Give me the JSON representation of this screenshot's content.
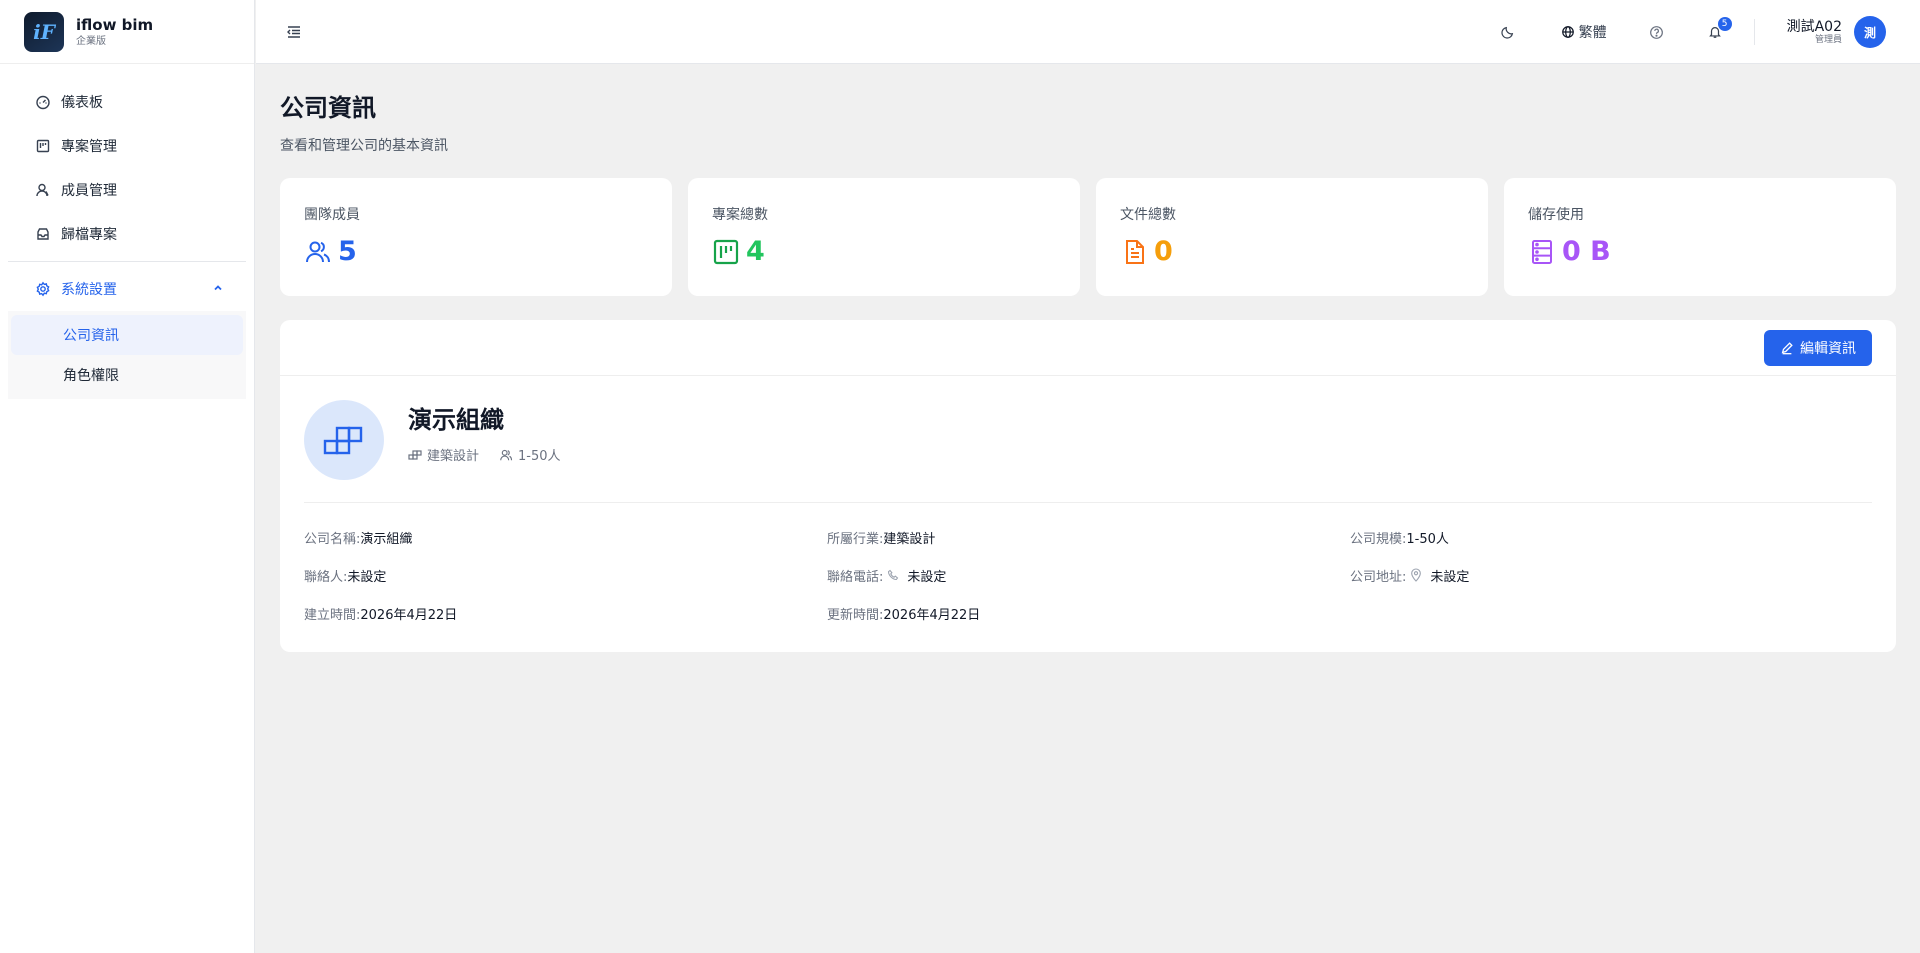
{
  "brand": {
    "logo_text": "iF",
    "name": "iflow bim",
    "edition": "企業版"
  },
  "nav": {
    "items": [
      {
        "label": "儀表板",
        "icon": "dashboard-icon"
      },
      {
        "label": "專案管理",
        "icon": "kanban-icon"
      },
      {
        "label": "成員管理",
        "icon": "user-icon"
      },
      {
        "label": "歸檔專案",
        "icon": "archive-icon"
      }
    ],
    "settings": {
      "label": "系統設置",
      "icon": "gear-icon",
      "expanded": true
    },
    "sub_items": [
      {
        "label": "公司資訊",
        "active": true
      },
      {
        "label": "角色權限",
        "active": false
      }
    ]
  },
  "header": {
    "language_label": "繁體",
    "notification_count": "5",
    "user_name": "測試A02",
    "user_role": "管理員",
    "avatar_text": "測"
  },
  "page": {
    "title": "公司資訊",
    "subtitle": "查看和管理公司的基本資訊"
  },
  "stats": [
    {
      "label": "團隊成員",
      "value": "5",
      "color": "#2563eb",
      "icon": "users-icon"
    },
    {
      "label": "專案總數",
      "value": "4",
      "color": "#22c55e",
      "icon": "kanban-icon"
    },
    {
      "label": "文件總數",
      "value": "0",
      "color": "#f59e0b",
      "icon": "file-icon"
    },
    {
      "label": "儲存使用",
      "value": "0 B",
      "color": "#a855f7",
      "icon": "server-icon"
    }
  ],
  "company": {
    "edit_label": "編輯資訊",
    "name": "演示組織",
    "industry_tag": "建築設計",
    "size_tag": "1-50人",
    "details": {
      "name_label": "公司名稱:",
      "name_value": "演示組織",
      "industry_label": "所屬行業:",
      "industry_value": "建築設計",
      "size_label": "公司規模:",
      "size_value": "1-50人",
      "contact_label": "聯絡人:",
      "contact_value": "未設定",
      "phone_label": "聯絡電話:",
      "phone_value": "未設定",
      "address_label": "公司地址:",
      "address_value": "未設定",
      "created_label": "建立時間:",
      "created_value": "2026年4月22日",
      "updated_label": "更新時間:",
      "updated_value": "2026年4月22日"
    }
  },
  "colors": {
    "accent": "#2563eb",
    "background": "#f0f0f0"
  }
}
